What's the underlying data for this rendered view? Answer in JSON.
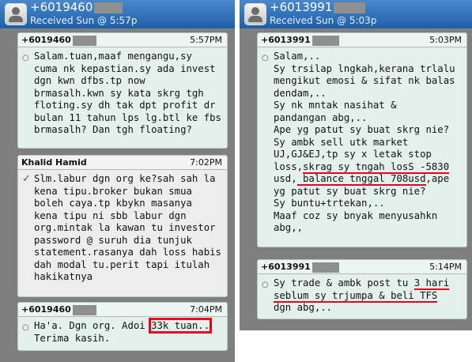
{
  "left": {
    "header": {
      "number": "+6019460",
      "subtitle": "Received Sun @ 5:57p"
    },
    "messages": [
      {
        "sender": "+6019460",
        "time": "5:57PM",
        "lines": [
          "Salam.tuan,maaf mengangu,sy",
          "cuma nk kepastian.sy ada invest",
          "dgn kwn dfbs.tp now",
          "brmasalh.kwn sy kata skrg tgh",
          "floting.sy dh tak dpt profit dr",
          "bulan 11 tahun lps lg.btl ke fbs",
          "brmasalh? Dan tgh floating?"
        ]
      },
      {
        "sender": "Khalid Hamid",
        "time": "7:02PM",
        "lines": [
          "Slm.labur dgn org ke?sah sah la",
          "kena tipu.broker bukan smua",
          "boleh caya.tp kbykn masanya",
          "kena tipu ni sbb labur dgn",
          "org.mintak la kawan tu investor",
          "password @ suruh dia tunjuk",
          "statement.rasanya dah loss habis",
          "dah modal tu.perit tapi itulah",
          "hakikatnya"
        ]
      },
      {
        "sender": "+6019460",
        "time": "7:04PM",
        "line1_a": "Ha'a. Dgn org. Adoi ",
        "line1_b": "33k tuan..",
        "line2": "Terima kasih."
      }
    ]
  },
  "right": {
    "header": {
      "number": "+6013991",
      "subtitle": "Received Sun @ 5:03p"
    },
    "messages": [
      {
        "sender": "+6013991",
        "time": "5:03PM",
        "l1": "Salam,..",
        "l2": "Sy trsilap lngkah,kerana trlalu",
        "l3": "mengikut emosi & sifat nk balas",
        "l4": "dendam,..",
        "l5": "Sy nk mntak nasihat &",
        "l6": "pandangan abg,..",
        "l7": "Ape yg patut sy buat skrg nie?",
        "l8": "Sy ambk sell utk market",
        "l9": "UJ,GJ&EJ,tp sy x letak stop",
        "l10a": "loss,",
        "l10b": "skrag sy tngah losS -5830",
        "l11a": "usd,",
        "l11b": " balance tnggal 708usd",
        "l11c": ",ape",
        "l12": "yg patut sy buat skrg nie?",
        "l13": "Sy buntu+trtekan,..",
        "l14": "Maaf coz sy bnyak menyusahkn",
        "l15": "abg,,"
      },
      {
        "sender": "+6013991",
        "time": "5:14PM",
        "l1a": "Sy trade & ambk post tu ",
        "l1b": "3 hari",
        "l2": "seblum sy trjumpa & beli TFS",
        "l3": "dgn abg,.."
      }
    ]
  },
  "colors": {
    "highlight": "#e8001e",
    "header": "#1d5fa8"
  }
}
